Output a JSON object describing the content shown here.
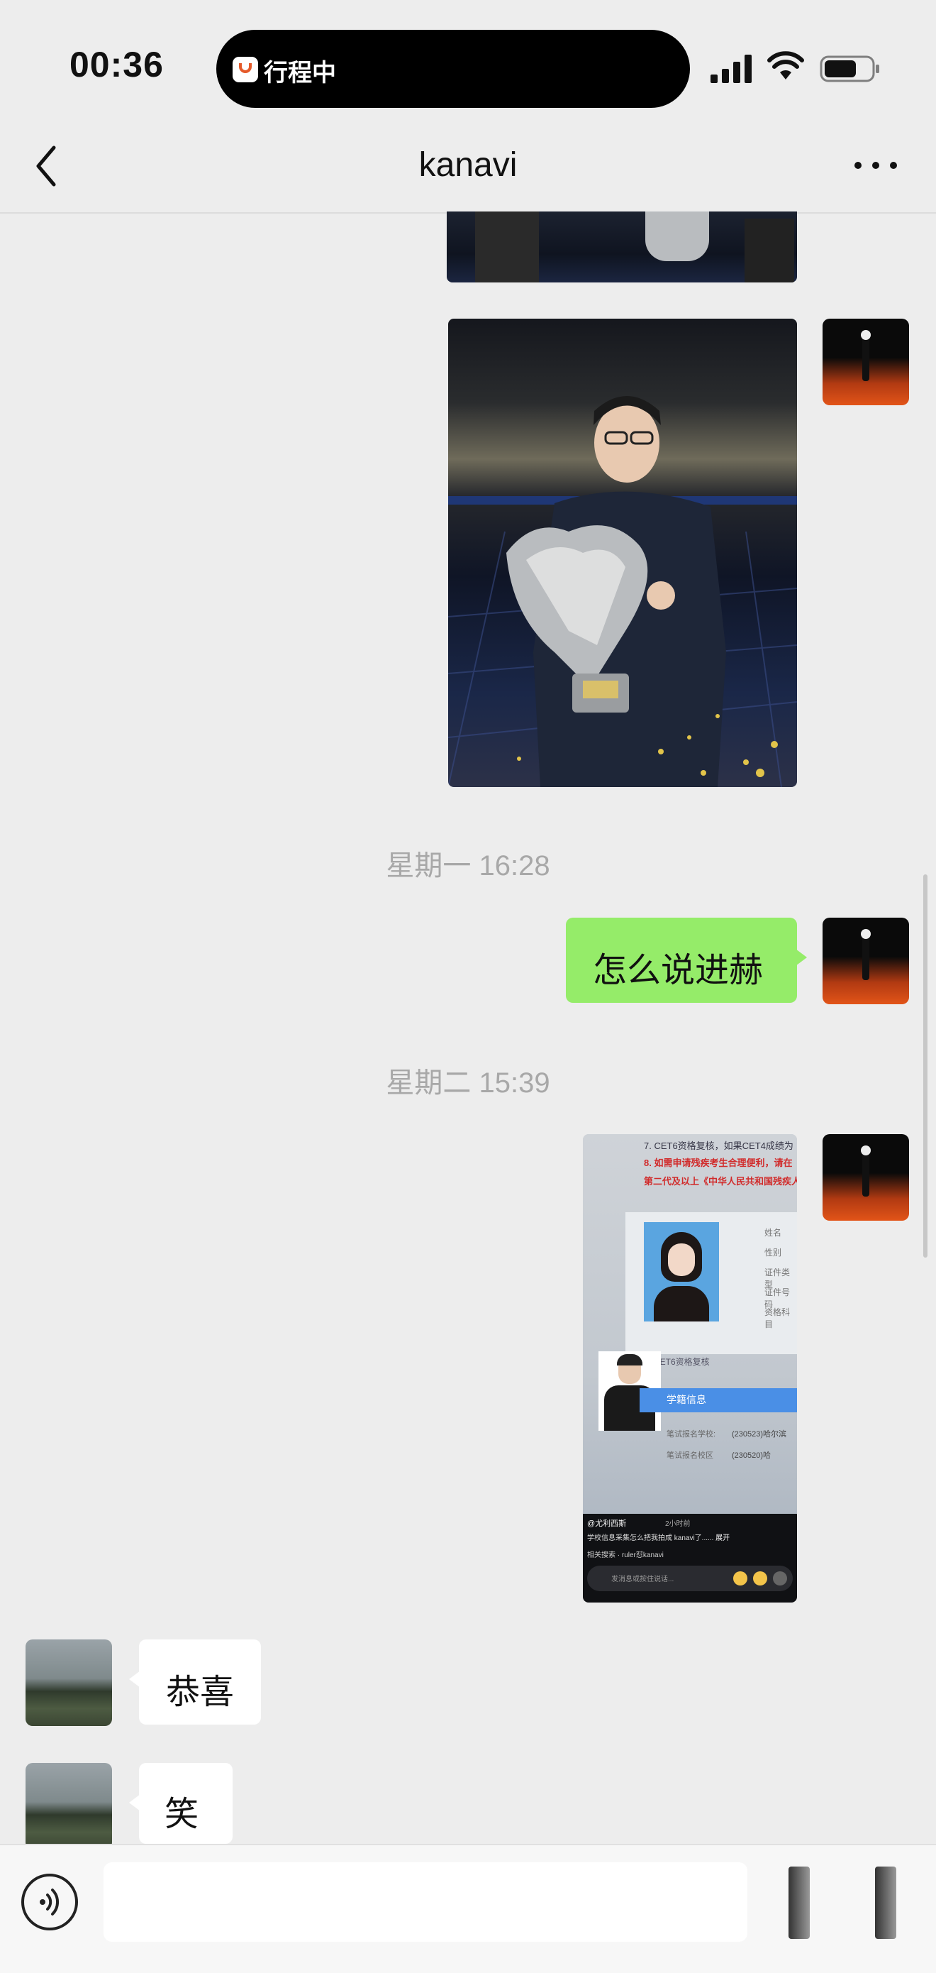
{
  "status_bar": {
    "time": "00:36",
    "live_activity_text": "行程中"
  },
  "nav": {
    "title": "kanavi"
  },
  "messages": {
    "timestamp_1": "星期一 16:28",
    "sent_text_1": "怎么说进赫",
    "timestamp_2": "星期二 15:39",
    "received_text_1": "恭喜",
    "received_text_2": "笑"
  },
  "screenshot_card": {
    "red_line_1": "8. 如需申请残疾考生合理便利，请在",
    "red_line_2": "第二代及以上《中华人民共和国残疾人",
    "top_line": "7. CET6资格复核，如果CET4成绩为",
    "side_labels": [
      "姓名",
      "性别",
      "证件类型",
      "证件号码",
      "资格科目"
    ],
    "tag": "CET6资格复核",
    "section": "学籍信息",
    "row1_label": "笔试报名学校:",
    "row1_value": "(230523)哈尔滨",
    "row2_label": "笔试报名校区",
    "row2_value": "(230520)哈",
    "author": "@尤利西斯",
    "author_meta": "2小时前",
    "caption": "学校信息采集怎么把我拍成 kanavi了......",
    "caption_more": "展开",
    "related": "相关搜索 · ruler怼kanavi",
    "input_hint": "发消息或按住说话..."
  },
  "input_bar": {
    "placeholder": ""
  },
  "colors": {
    "background": "#ededed",
    "sent_bubble": "#95ec69",
    "received_bubble": "#ffffff",
    "timestamp_text": "#a8a8a8"
  },
  "icons": {
    "back": "chevron-left-icon",
    "more": "more-dots-icon",
    "voice": "voice-icon",
    "signal": "signal-icon",
    "wifi": "wifi-icon",
    "battery": "battery-icon"
  }
}
